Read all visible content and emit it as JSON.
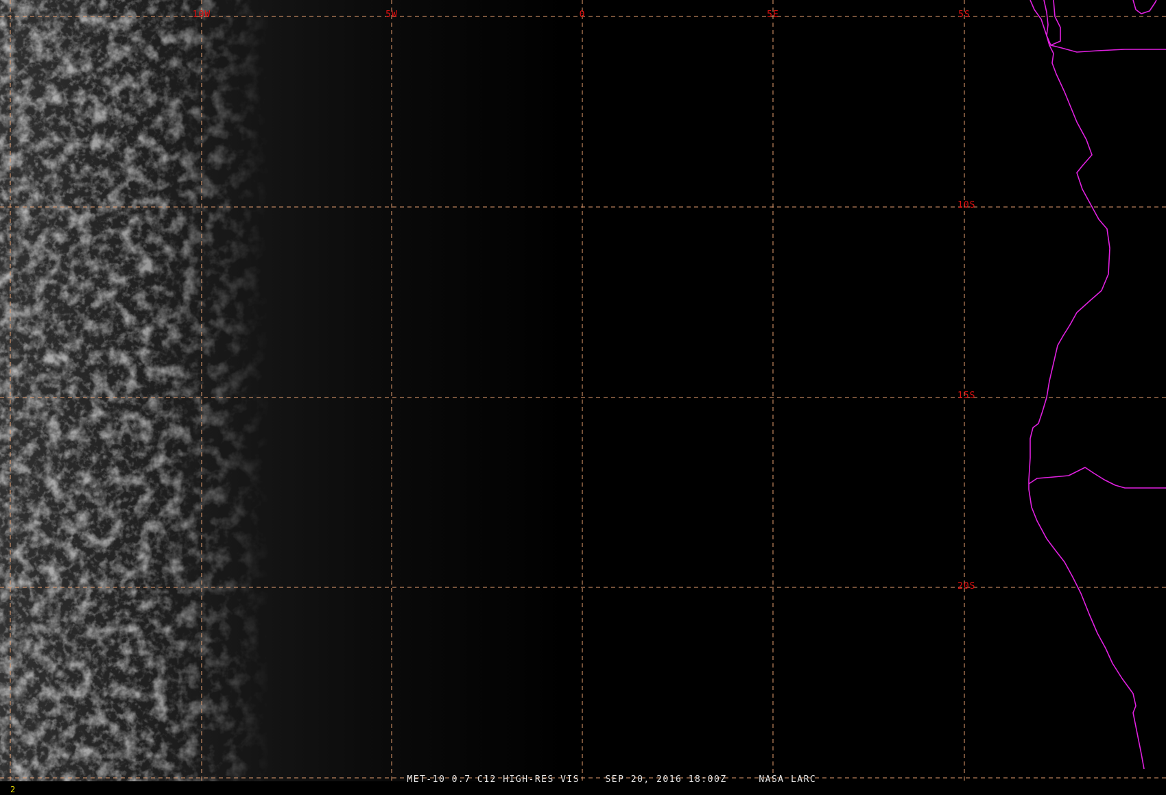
{
  "colors": {
    "background": "#000000",
    "grid_line": "#e8a070",
    "grid_label": "#e01010",
    "coastline": "#e020e0",
    "caption": "#e8e8e8",
    "frame_number": "#f0e000",
    "cloud": "#8a8a8a"
  },
  "map": {
    "projection": "satellite image, lat/lon grid every 5 degrees",
    "longitude_labels": [
      "10W",
      "5W",
      "0",
      "5E",
      "5S"
    ],
    "latitude_labels": [
      "10S",
      "15S",
      "20S"
    ],
    "grid_style": "dashed",
    "coastline_overlay": "western Africa coast (Angola / Namibia) with border lines"
  },
  "footer": {
    "frame_number": "2",
    "caption_parts": [
      "MET-10 0.7 C12 HIGH-RES VIS",
      "SEP 20, 2016 18:00Z",
      "NASA LARC"
    ]
  }
}
